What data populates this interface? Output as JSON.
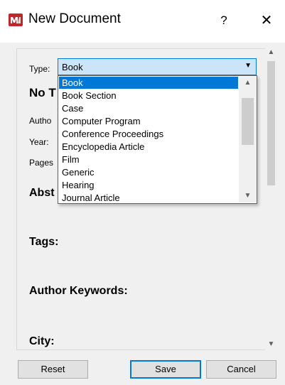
{
  "window": {
    "title": "New Document",
    "help_label": "?",
    "close_label": "✕"
  },
  "form": {
    "type_label": "Type:",
    "type_value": "Book",
    "title_label": "No T",
    "author_label": "Autho",
    "year_label": "Year:",
    "pages_label": "Pages",
    "abstract_label": "Abst",
    "tags_label": "Tags:",
    "keywords_label": "Author Keywords:",
    "city_label": "City:"
  },
  "dropdown": {
    "options": [
      "Book",
      "Book Section",
      "Case",
      "Computer Program",
      "Conference Proceedings",
      "Encyclopedia Article",
      "Film",
      "Generic",
      "Hearing",
      "Journal Article"
    ],
    "selected_index": 0
  },
  "buttons": {
    "reset": "Reset",
    "save": "Save",
    "cancel": "Cancel"
  },
  "colors": {
    "accent": "#0078d7",
    "brand": "#c0272d",
    "combo_bg": "#cce4f7"
  }
}
